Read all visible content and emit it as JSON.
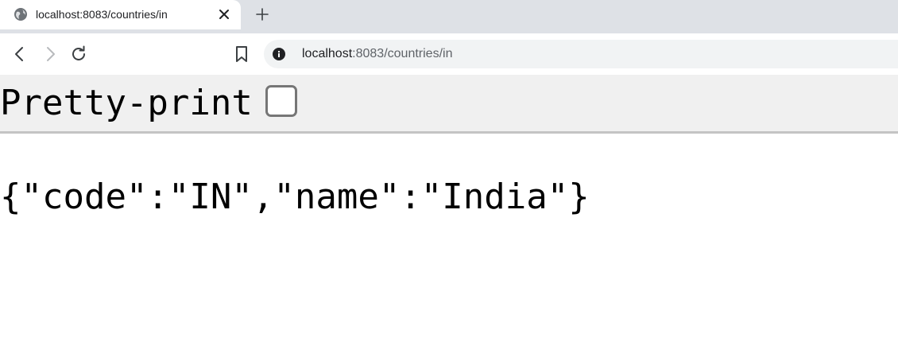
{
  "browser": {
    "tab": {
      "title": "localhost:8083/countries/in",
      "favicon": "globe-icon",
      "close_icon": "close-icon"
    },
    "new_tab_icon": "plus-icon",
    "toolbar": {
      "back_icon": "back-arrow-icon",
      "forward_icon": "forward-arrow-icon",
      "reload_icon": "reload-icon",
      "bookmark_icon": "bookmark-icon",
      "info_icon": "info-icon"
    },
    "address_bar": {
      "host": "localhost",
      "path": ":8083/countries/in"
    }
  },
  "viewer": {
    "pretty_print_label": "Pretty-print",
    "pretty_print_checked": false
  },
  "content": {
    "json_text": "{\"code\":\"IN\",\"name\":\"India\"}"
  },
  "colors": {
    "tabstrip": "#dee1e6",
    "omnibox": "#f1f3f4",
    "pretty_print_bar": "#f0f0f0"
  }
}
